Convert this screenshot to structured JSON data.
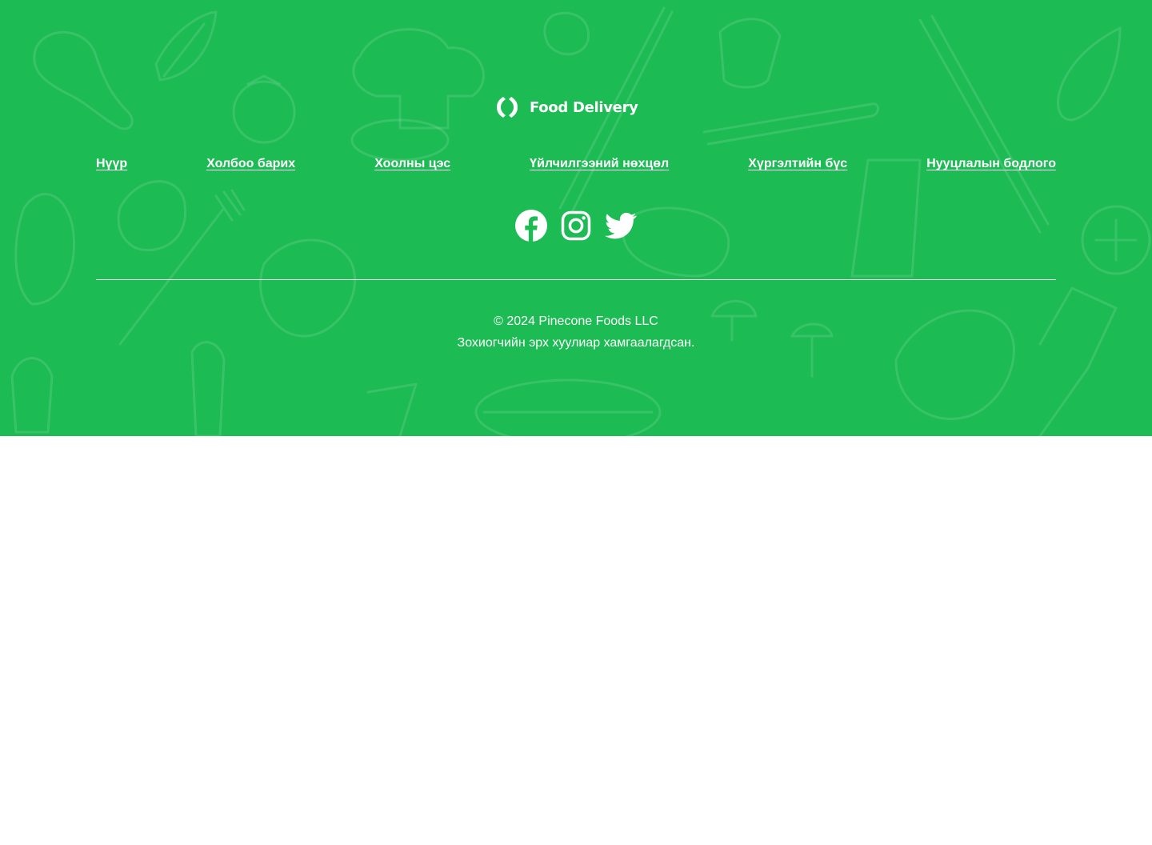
{
  "footer": {
    "background_color": "#1cbb53",
    "logo": {
      "text": "Food Delivery",
      "icon": "brackets-logo-icon"
    },
    "nav_links": [
      "Нүүр",
      "Холбоо барих",
      "Хоолны цэс",
      "Үйлчилгээний нөхцөл",
      "Хүргэлтийн бүс",
      "Нууцлалын бодлого"
    ],
    "social": [
      {
        "name": "facebook",
        "icon": "facebook-icon"
      },
      {
        "name": "instagram",
        "icon": "instagram-icon"
      },
      {
        "name": "twitter",
        "icon": "twitter-icon"
      }
    ],
    "copyright_line1": "© 2024 Pinecone Foods LLC",
    "copyright_line2": "Зохиогчийн эрх хуулиар хамгаалагдсан."
  }
}
